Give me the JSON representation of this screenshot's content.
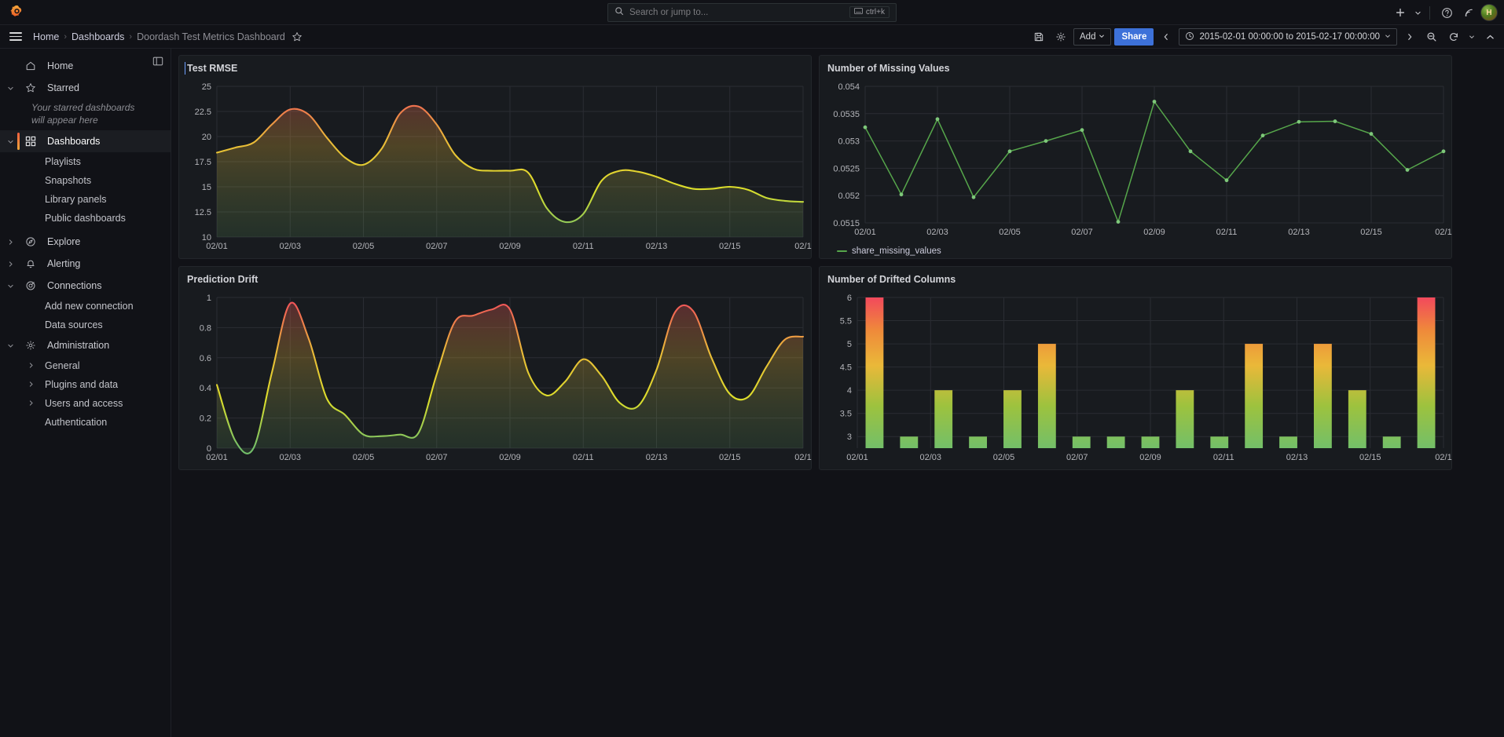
{
  "app": {
    "logo_icon": "grafana-logo-icon"
  },
  "search": {
    "placeholder": "Search or jump to...",
    "shortcut": "ctrl+k",
    "icon": "search-icon",
    "kbd_icon": "keyboard-icon"
  },
  "topbar_right": {
    "add_icon": "plus-icon",
    "add_caret_icon": "chevron-down-icon",
    "help_icon": "help-circle-icon",
    "news_icon": "rss-icon",
    "avatar_icon": "user-avatar",
    "avatar_initial": "H"
  },
  "breadcrumb": {
    "menu_icon": "hamburger-menu-icon",
    "items": [
      {
        "label": "Home",
        "current": false
      },
      {
        "label": "Dashboards",
        "current": false
      },
      {
        "label": "Doordash Test Metrics Dashboard",
        "current": true
      }
    ],
    "separator": "›",
    "star_icon": "star-outline-icon"
  },
  "toolbar": {
    "save_icon": "save-icon",
    "settings_icon": "gear-icon",
    "add_label": "Add",
    "add_caret_icon": "chevron-down-icon",
    "share_label": "Share",
    "time_prev_icon": "chevron-left-icon",
    "time_clock_icon": "clock-icon",
    "time_range": "2015-02-01 00:00:00 to 2015-02-17 00:00:00",
    "time_caret_icon": "chevron-down-icon",
    "time_next_icon": "chevron-right-icon",
    "zoom_out_icon": "zoom-out-icon",
    "refresh_icon": "refresh-icon",
    "refresh_caret_icon": "chevron-down-icon",
    "collapse_icon": "chevron-up-icon"
  },
  "sidebar": {
    "dock_icon": "dock-panel-icon",
    "items": [
      {
        "label": "Home",
        "icon": "home-icon",
        "type": "item",
        "chevron": "",
        "active": false
      },
      {
        "label": "Starred",
        "icon": "star-icon",
        "type": "item",
        "chevron": "down",
        "active": false
      },
      {
        "label": "Your starred dashboards will appear here",
        "type": "note"
      },
      {
        "label": "Dashboards",
        "icon": "dashboards-grid-icon",
        "type": "item",
        "chevron": "down",
        "active": true
      },
      {
        "label": "Playlists",
        "type": "sub",
        "chevron": ""
      },
      {
        "label": "Snapshots",
        "type": "sub",
        "chevron": ""
      },
      {
        "label": "Library panels",
        "type": "sub",
        "chevron": ""
      },
      {
        "label": "Public dashboards",
        "type": "sub",
        "chevron": ""
      },
      {
        "label": "Explore",
        "icon": "compass-icon",
        "type": "item",
        "chevron": "right",
        "active": false
      },
      {
        "label": "Alerting",
        "icon": "bell-icon",
        "type": "item",
        "chevron": "right",
        "active": false
      },
      {
        "label": "Connections",
        "icon": "connections-icon",
        "type": "item",
        "chevron": "down",
        "active": false
      },
      {
        "label": "Add new connection",
        "type": "sub",
        "chevron": ""
      },
      {
        "label": "Data sources",
        "type": "sub",
        "chevron": ""
      },
      {
        "label": "Administration",
        "icon": "gear-icon",
        "type": "item",
        "chevron": "down",
        "active": false
      },
      {
        "label": "General",
        "type": "sub",
        "chevron": "right"
      },
      {
        "label": "Plugins and data",
        "type": "sub",
        "chevron": "right"
      },
      {
        "label": "Users and access",
        "type": "sub",
        "chevron": "right"
      },
      {
        "label": "Authentication",
        "type": "sub",
        "chevron": ""
      }
    ]
  },
  "panels": [
    {
      "title": "Test RMSE"
    },
    {
      "title": "Number of Missing Values"
    },
    {
      "title": "Prediction Drift"
    },
    {
      "title": "Number of Drifted Columns"
    }
  ],
  "chart_data": [
    {
      "id": "test-rmse",
      "type": "area",
      "title": "Test RMSE",
      "xlabel": "",
      "ylabel": "",
      "ylim": [
        10,
        25
      ],
      "yticks": [
        10,
        12.5,
        15,
        17.5,
        20,
        22.5,
        25
      ],
      "ytick_labels": [
        "10",
        "12.5",
        "15",
        "17.5",
        "20",
        "22.5",
        "25"
      ],
      "xticks": [
        "02/01",
        "02/03",
        "02/05",
        "02/07",
        "02/09",
        "02/11",
        "02/13",
        "02/15",
        "02/1"
      ],
      "grid": true,
      "legend": null,
      "color_scheme": "green-yellow-red-gradient",
      "x": [
        "02/01",
        "02/01",
        "02/02",
        "02/02",
        "02/03",
        "02/03",
        "02/04",
        "02/04",
        "02/05",
        "02/05",
        "02/06",
        "02/06",
        "02/07",
        "02/07",
        "02/08",
        "02/08",
        "02/09",
        "02/09",
        "02/10",
        "02/10",
        "02/11",
        "02/11",
        "02/12",
        "02/12",
        "02/13",
        "02/13",
        "02/14",
        "02/14",
        "02/15",
        "02/15",
        "02/16",
        "02/16",
        "02/17"
      ],
      "values": [
        18.4,
        18.9,
        19.4,
        21.2,
        22.7,
        22.2,
        19.9,
        17.9,
        17.2,
        18.8,
        22.3,
        23.0,
        21.2,
        18.2,
        16.8,
        16.6,
        16.6,
        16.4,
        12.9,
        11.5,
        12.3,
        15.6,
        16.6,
        16.5,
        16.0,
        15.3,
        14.8,
        14.8,
        15.0,
        14.7,
        13.9,
        13.6,
        13.5
      ]
    },
    {
      "id": "missing-values",
      "type": "line",
      "title": "Number of Missing Values",
      "xlabel": "",
      "ylabel": "",
      "ylim": [
        0.0515,
        0.054
      ],
      "yticks": [
        0.0515,
        0.052,
        0.0525,
        0.053,
        0.0535,
        0.054
      ],
      "ytick_labels": [
        "0.0515",
        "0.052",
        "0.0525",
        "0.053",
        "0.0535",
        "0.054"
      ],
      "xticks": [
        "02/01",
        "02/03",
        "02/05",
        "02/07",
        "02/09",
        "02/11",
        "02/13",
        "02/15",
        "02/1"
      ],
      "grid": true,
      "legend": {
        "position": "bottom",
        "entries": [
          {
            "label": "share_missing_values",
            "color": "#56a64b"
          }
        ]
      },
      "line_color": "#56a64b",
      "x": [
        "02/01",
        "02/02",
        "02/03",
        "02/04",
        "02/05",
        "02/06",
        "02/07",
        "02/08",
        "02/09",
        "02/10",
        "02/11",
        "02/12",
        "02/13",
        "02/14",
        "02/15",
        "02/16",
        "02/17"
      ],
      "values": [
        0.05325,
        0.05202,
        0.0534,
        0.05197,
        0.05281,
        0.053,
        0.0532,
        0.05152,
        0.05372,
        0.05281,
        0.05228,
        0.0531,
        0.05335,
        0.05336,
        0.05313,
        0.05247,
        0.05281
      ]
    },
    {
      "id": "prediction-drift",
      "type": "area",
      "title": "Prediction Drift",
      "xlabel": "",
      "ylabel": "",
      "ylim": [
        0,
        1
      ],
      "yticks": [
        0,
        0.2,
        0.4,
        0.6,
        0.8,
        1
      ],
      "ytick_labels": [
        "0",
        "0.2",
        "0.4",
        "0.6",
        "0.8",
        "1"
      ],
      "xticks": [
        "02/01",
        "02/03",
        "02/05",
        "02/07",
        "02/09",
        "02/11",
        "02/13",
        "02/15",
        "02/1"
      ],
      "grid": true,
      "legend": null,
      "color_scheme": "green-yellow-red-gradient",
      "x": [
        "02/01",
        "02/01",
        "02/02",
        "02/02",
        "02/03",
        "02/03",
        "02/04",
        "02/04",
        "02/05",
        "02/05",
        "02/06",
        "02/06",
        "02/07",
        "02/07",
        "02/08",
        "02/08",
        "02/09",
        "02/09",
        "02/10",
        "02/10",
        "02/11",
        "02/11",
        "02/12",
        "02/12",
        "02/13",
        "02/13",
        "02/14",
        "02/14",
        "02/15",
        "02/15",
        "02/16",
        "02/16",
        "02/17"
      ],
      "values": [
        0.42,
        0.05,
        0.0,
        0.5,
        0.96,
        0.73,
        0.33,
        0.22,
        0.09,
        0.08,
        0.09,
        0.1,
        0.49,
        0.84,
        0.88,
        0.92,
        0.92,
        0.5,
        0.35,
        0.44,
        0.59,
        0.48,
        0.3,
        0.28,
        0.52,
        0.9,
        0.91,
        0.6,
        0.36,
        0.34,
        0.54,
        0.72,
        0.74
      ]
    },
    {
      "id": "drifted-columns",
      "type": "bar",
      "title": "Number of Drifted Columns",
      "xlabel": "",
      "ylabel": "",
      "ylim": [
        2.75,
        6
      ],
      "yticks": [
        3,
        3.5,
        4,
        4.5,
        5,
        5.5,
        6
      ],
      "ytick_labels": [
        "3",
        "3.5",
        "4",
        "4.5",
        "5",
        "5.5",
        "6"
      ],
      "xticks": [
        "02/01",
        "02/03",
        "02/05",
        "02/07",
        "02/09",
        "02/11",
        "02/13",
        "02/15",
        "02/1"
      ],
      "grid": true,
      "legend": null,
      "color_scheme": "green-yellow-red-gradient",
      "categories": [
        "02/01",
        "02/02",
        "02/03",
        "02/04",
        "02/05",
        "02/06",
        "02/07",
        "02/08",
        "02/09",
        "02/10",
        "02/11",
        "02/12",
        "02/13",
        "02/14",
        "02/15",
        "02/16",
        "02/17"
      ],
      "values": [
        6,
        3,
        4,
        3,
        4,
        5,
        3,
        3,
        3,
        4,
        3,
        5,
        3,
        5,
        4,
        3,
        6
      ]
    }
  ],
  "colors": {
    "background": "#111217",
    "panel_bg": "#181b1f",
    "accent_blue": "#3d71d9",
    "green": "#56a64b",
    "text": "#ccccdc"
  }
}
